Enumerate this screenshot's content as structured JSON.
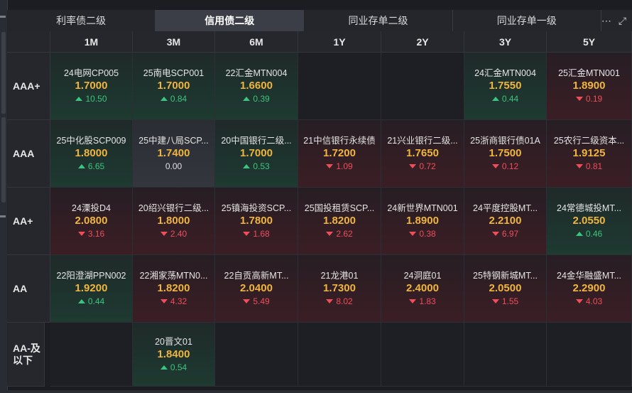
{
  "tabs": [
    "利率债二级",
    "信用债二级",
    "同业存单二级",
    "同业存单一级"
  ],
  "active_tab": 1,
  "toolbar": {
    "more_icon": "⋯",
    "expand_icon": "⤢"
  },
  "columns": [
    "1M",
    "3M",
    "6M",
    "1Y",
    "2Y",
    "3Y",
    "5Y"
  ],
  "rows": [
    {
      "label": "AAA+",
      "cells": [
        {
          "name": "24电网CP005",
          "rate": "1.7000",
          "change": "10.50",
          "dir": "up"
        },
        {
          "name": "25南电SCP001",
          "rate": "1.7000",
          "change": "0.84",
          "dir": "up"
        },
        {
          "name": "22汇金MTN004",
          "rate": "1.6600",
          "change": "0.39",
          "dir": "up"
        },
        null,
        null,
        {
          "name": "24汇金MTN004",
          "rate": "1.7550",
          "change": "0.44",
          "dir": "up"
        },
        {
          "name": "25汇金MTN001",
          "rate": "1.8900",
          "change": "0.19",
          "dir": "down"
        }
      ]
    },
    {
      "label": "AAA",
      "cells": [
        {
          "name": "25中化股SCP009",
          "rate": "1.8000",
          "change": "6.65",
          "dir": "up"
        },
        {
          "name": "25中建八局SCP...",
          "rate": "1.7400",
          "change": "0.00",
          "dir": "flat"
        },
        {
          "name": "20中国银行二级...",
          "rate": "1.7000",
          "change": "0.53",
          "dir": "up"
        },
        {
          "name": "21中信银行永续债",
          "rate": "1.7200",
          "change": "1.09",
          "dir": "down"
        },
        {
          "name": "21兴业银行二级...",
          "rate": "1.7650",
          "change": "0.72",
          "dir": "down"
        },
        {
          "name": "25浙商银行债01A",
          "rate": "1.7500",
          "change": "0.12",
          "dir": "down"
        },
        {
          "name": "25农行二级资本...",
          "rate": "1.9125",
          "change": "0.81",
          "dir": "down"
        }
      ]
    },
    {
      "label": "AA+",
      "cells": [
        {
          "name": "24溧投D4",
          "rate": "2.0800",
          "change": "3.16",
          "dir": "down"
        },
        {
          "name": "20绍兴银行二级...",
          "rate": "1.8000",
          "change": "2.40",
          "dir": "down"
        },
        {
          "name": "25镇海投资SCP...",
          "rate": "1.7800",
          "change": "1.68",
          "dir": "down"
        },
        {
          "name": "25国投租赁SCP...",
          "rate": "1.8200",
          "change": "2.62",
          "dir": "down"
        },
        {
          "name": "24新世界MTN001",
          "rate": "1.8900",
          "change": "0.38",
          "dir": "down"
        },
        {
          "name": "24平度控股MT...",
          "rate": "2.2100",
          "change": "6.97",
          "dir": "down"
        },
        {
          "name": "24常德城投MT...",
          "rate": "2.0550",
          "change": "0.46",
          "dir": "up"
        }
      ]
    },
    {
      "label": "AA",
      "cells": [
        {
          "name": "22阳澄湖PPN002",
          "rate": "1.9200",
          "change": "0.44",
          "dir": "up"
        },
        {
          "name": "22湘家荡MTN0...",
          "rate": "1.8200",
          "change": "4.32",
          "dir": "down"
        },
        {
          "name": "22自贡高新MT...",
          "rate": "2.0400",
          "change": "5.49",
          "dir": "down"
        },
        {
          "name": "21龙港01",
          "rate": "1.7300",
          "change": "8.02",
          "dir": "down"
        },
        {
          "name": "24洞庭01",
          "rate": "2.4000",
          "change": "1.83",
          "dir": "down"
        },
        {
          "name": "25特钢新城MT...",
          "rate": "2.0500",
          "change": "1.55",
          "dir": "down"
        },
        {
          "name": "24金华融盛MT...",
          "rate": "2.2900",
          "change": "4.03",
          "dir": "down"
        }
      ]
    },
    {
      "label": "AA-及以下",
      "cells": [
        null,
        {
          "name": "20晋文01",
          "rate": "1.8400",
          "change": "0.54",
          "dir": "up"
        },
        null,
        null,
        null,
        null,
        null
      ]
    }
  ],
  "colors": {
    "rate": "#f0b53c",
    "up": "#3bc47f",
    "down": "#ef4d5a"
  }
}
